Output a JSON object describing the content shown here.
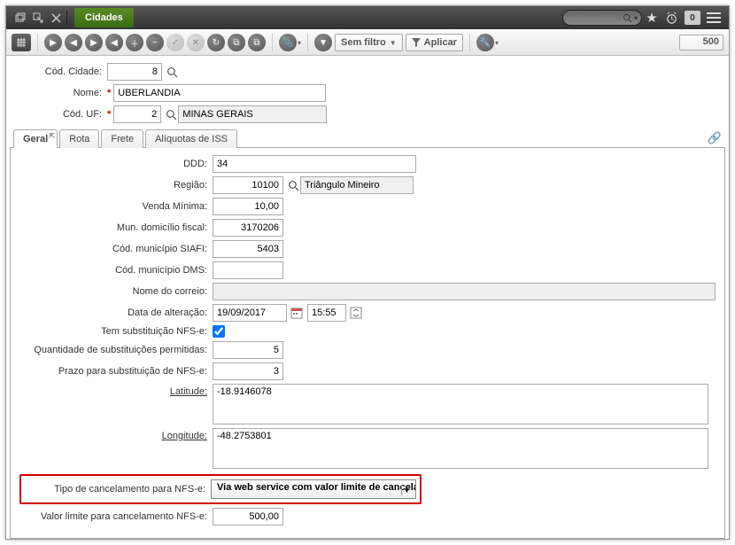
{
  "titlebar": {
    "title": "Cidades",
    "badge": "0"
  },
  "toolbar": {
    "filter_label": "Sem filtro",
    "apply_label": "Aplicar",
    "count": "500"
  },
  "header": {
    "cod_cidade_label": "Cód. Cidade:",
    "cod_cidade_value": "8",
    "nome_label": "Nome:",
    "nome_value": "UBERLANDIA",
    "cod_uf_label": "Cód. UF:",
    "cod_uf_value": "2",
    "uf_nome": "MINAS GERAIS"
  },
  "tabs": {
    "geral": "Geral",
    "rota": "Rota",
    "frete": "Frete",
    "aliq": "Alíquotas de ISS"
  },
  "geral": {
    "ddd_label": "DDD:",
    "ddd_value": "34",
    "regiao_label": "Região:",
    "regiao_code": "10100",
    "regiao_nome": "Triângulo Mineiro",
    "venda_min_label": "Venda Mínima:",
    "venda_min_value": "10,00",
    "mun_dom_label": "Mun. domicílio fiscal:",
    "mun_dom_value": "3170206",
    "siafi_label": "Cód. município SIAFI:",
    "siafi_value": "5403",
    "dms_label": "Cód. município DMS:",
    "dms_value": "",
    "correio_label": "Nome do correio:",
    "data_label": "Data de alteração:",
    "data_value": "19/09/2017",
    "hora_value": "15:55",
    "subst_label": "Tem substituição NFS-e:",
    "qtd_subst_label": "Quantidade de substituições permitidas:",
    "qtd_subst_value": "5",
    "prazo_label": "Prazo para substituição de NFS-e:",
    "prazo_value": "3",
    "lat_label": "Latitude:",
    "lat_value": "-18.9146078",
    "lon_label": "Longitude:",
    "lon_value": "-48.2753801",
    "tipo_canc_label": "Tipo de cancelamento para NFS-e:",
    "tipo_canc_value": "Via web service com valor limite de cancelame",
    "valor_lim_label": "Valor limite para cancelamento NFS-e:",
    "valor_lim_value": "500,00"
  }
}
